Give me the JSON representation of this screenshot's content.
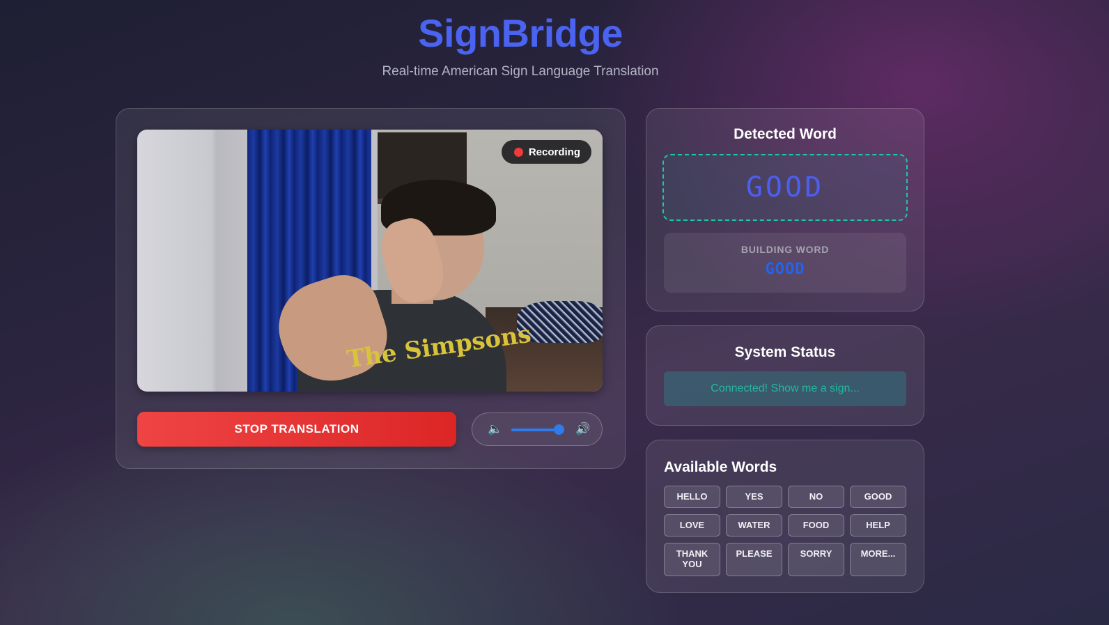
{
  "header": {
    "title": "SignBridge",
    "subtitle": "Real-time American Sign Language Translation"
  },
  "video": {
    "recording_label": "Recording",
    "shirt_text": "The Simpsons"
  },
  "controls": {
    "stop_label": "STOP TRANSLATION",
    "volume_level": 0.9,
    "volume_low_icon": "volume-low-icon",
    "volume_high_icon": "volume-high-icon"
  },
  "detected": {
    "title": "Detected Word",
    "word": "GOOD",
    "building_label": "BUILDING WORD",
    "building_value": "GOOD"
  },
  "status": {
    "title": "System Status",
    "message": "Connected! Show me a sign..."
  },
  "words": {
    "title": "Available Words",
    "items": [
      "HELLO",
      "YES",
      "NO",
      "GOOD",
      "LOVE",
      "WATER",
      "FOOD",
      "HELP",
      "THANK YOU",
      "PLEASE",
      "SORRY",
      "MORE..."
    ]
  },
  "colors": {
    "title_accent": "#4a63f0",
    "stop_button": "#ef4444",
    "detected_border": "#1fc7a6",
    "status_text": "#22b8a0",
    "recording_dot": "#ef3b3b"
  }
}
